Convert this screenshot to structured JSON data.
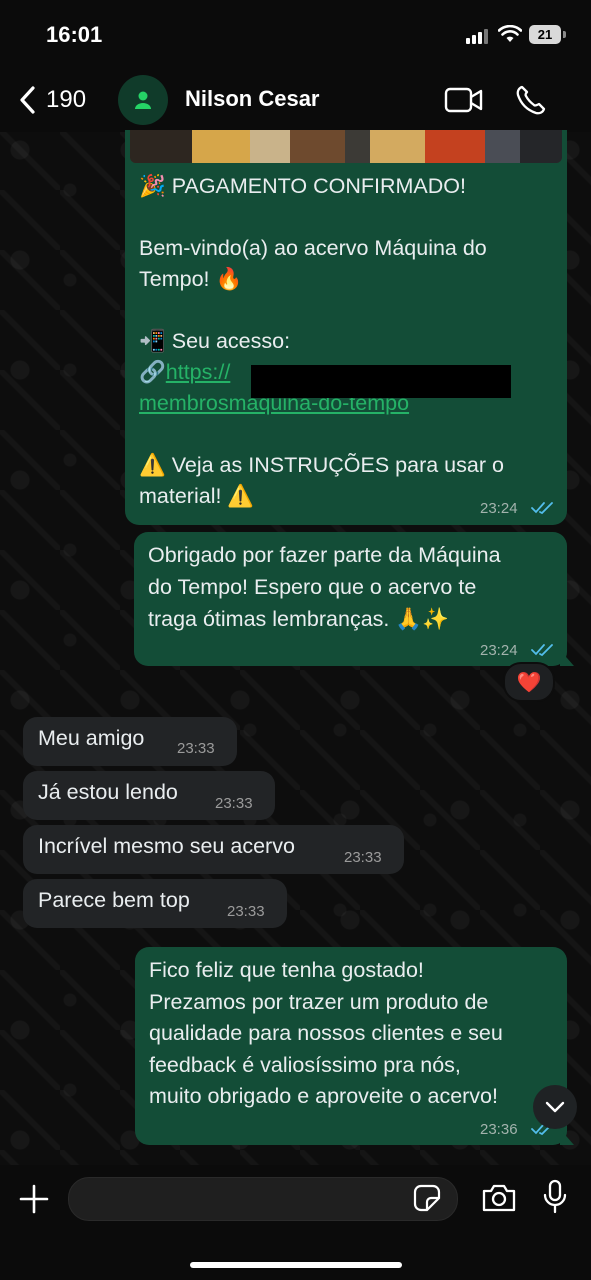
{
  "status_bar": {
    "time": "16:01",
    "battery": "21"
  },
  "header": {
    "back_count": "190",
    "contact_name": "Nilson Cesar"
  },
  "messages": [
    {
      "direction": "out",
      "lines": [
        "🎉 PAGAMENTO CONFIRMADO!",
        "",
        "Bem-vindo(a) ao acervo Máquina do",
        "Tempo! 🔥",
        "",
        "📲 Seu acesso:"
      ],
      "link_prefix": "🔗",
      "link_start": "https://",
      "link_end": "membrosmaquina-do-tempo",
      "after_link": [
        "⚠️ Veja as INSTRUÇÕES para usar o",
        "material! ⚠️"
      ],
      "time": "23:24"
    },
    {
      "direction": "out",
      "lines": [
        "Obrigado por fazer parte da Máquina",
        "do Tempo! Espero que o acervo te",
        "traga ótimas lembranças. 🙏✨"
      ],
      "time": "23:24",
      "reaction": "❤️"
    },
    {
      "direction": "in",
      "text": "Meu amigo",
      "time": "23:33"
    },
    {
      "direction": "in",
      "text": "Já estou lendo",
      "time": "23:33"
    },
    {
      "direction": "in",
      "text": "Incrível mesmo seu acervo",
      "time": "23:33"
    },
    {
      "direction": "in",
      "text": "Parece bem top",
      "time": "23:33"
    },
    {
      "direction": "out",
      "lines": [
        "Fico feliz que tenha gostado!",
        "Prezamos por trazer um produto de",
        "qualidade para nossos clientes e seu",
        "feedback é valiosíssimo pra nós,",
        "muito obrigado e aproveite o acervo!"
      ],
      "time": "23:36"
    }
  ],
  "composer": {
    "placeholder": ""
  },
  "colors": {
    "outgoing_bubble": "#134d37",
    "incoming_bubble": "#222426",
    "link": "#25b267",
    "read_ticks": "#53bdeb"
  }
}
